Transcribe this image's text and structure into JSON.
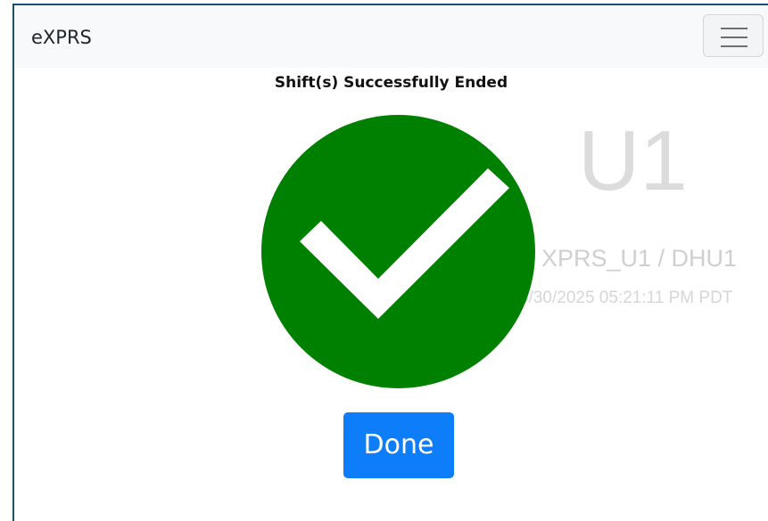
{
  "navbar": {
    "brand": "eXPRS",
    "toggler_icon": "hamburger-menu-icon"
  },
  "status": {
    "message": "Shift(s) Successfully Ended",
    "icon": "check-circle-icon",
    "icon_color": "#008000"
  },
  "background_info": {
    "unit": "U1",
    "site": "XPRS_U1 / DHU1",
    "timestamp": "5/30/2025 05:21:11 PM PDT"
  },
  "actions": {
    "done_label": "Done",
    "done_color": "#0d7dfa"
  }
}
